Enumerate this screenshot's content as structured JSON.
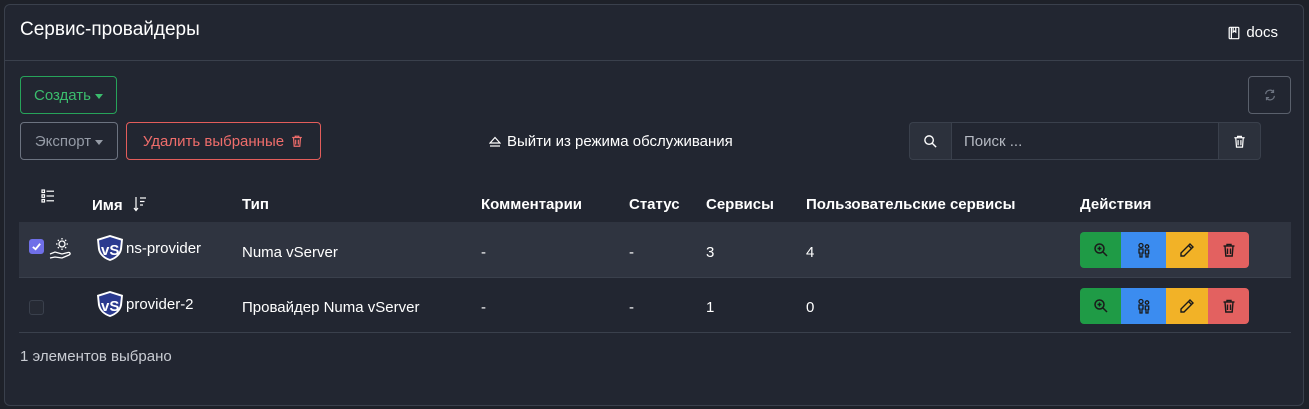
{
  "header": {
    "title": "Сервис-провайдеры",
    "docs_label": "docs"
  },
  "toolbar": {
    "create_label": "Создать",
    "export_label": "Экспорт",
    "delete_selected_label": "Удалить выбранные",
    "maintenance_label": "Выйти из режима обслуживания",
    "search_placeholder": "Поиск ..."
  },
  "table": {
    "columns": [
      "Имя",
      "Тип",
      "Комментарии",
      "Статус",
      "Сервисы",
      "Пользовательские сервисы",
      "Действия"
    ],
    "rows": [
      {
        "selected": true,
        "name": "ns-provider",
        "type": "Numa vServer",
        "comments": "-",
        "status": "-",
        "services": "3",
        "custom_services": "4"
      },
      {
        "selected": false,
        "name": "provider-2",
        "type": "Провайдер Numa vServer",
        "comments": "-",
        "status": "-",
        "services": "1",
        "custom_services": "0"
      }
    ]
  },
  "footer": {
    "selection_text": "1 элементов выбрано"
  },
  "colors": {
    "create": "#27a35a",
    "delete": "#e35d5b",
    "view": "#1f9b46",
    "users": "#3b8cf0",
    "edit": "#f2b227",
    "remove": "#e36160",
    "checkbox": "#6f6fe8"
  }
}
